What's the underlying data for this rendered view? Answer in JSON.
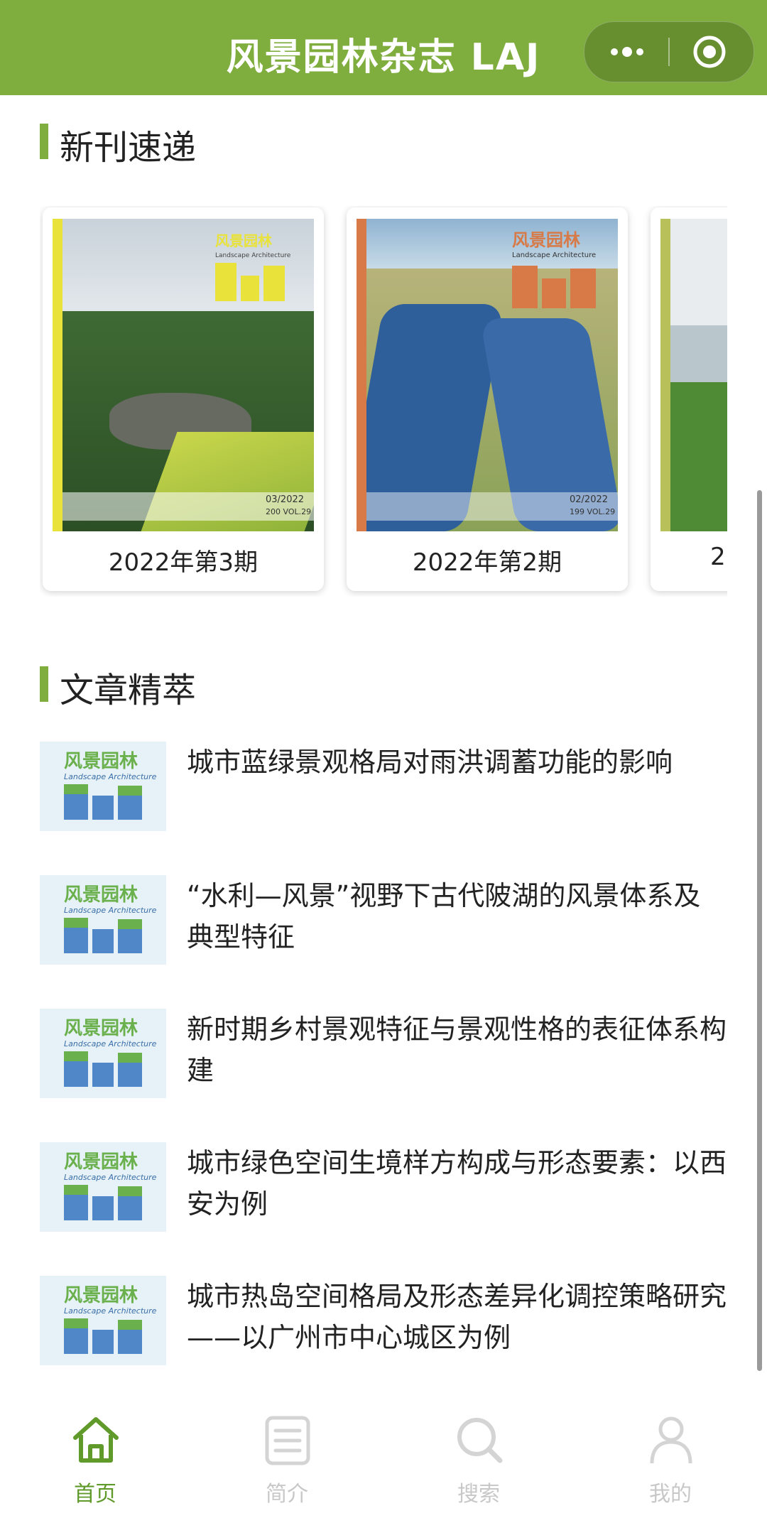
{
  "header": {
    "title": "风景园林杂志 LAJ"
  },
  "colors": {
    "brand": "#7fad3e",
    "tab_active": "#5f9a2a",
    "tab_inactive": "#c8c8c8"
  },
  "new_issues": {
    "heading": "新刊速递",
    "cards": [
      {
        "label": "2022年第3期",
        "cover_issue": "03/2022",
        "cover_vol": "200 VOL.29"
      },
      {
        "label": "2022年第2期",
        "cover_issue": "02/2022",
        "cover_vol": "199 VOL.29"
      },
      {
        "label": "2"
      }
    ],
    "cover_brand": "风景园林",
    "cover_brand_en": "Landscape Architecture"
  },
  "articles": {
    "heading": "文章精萃",
    "thumb_brand": "风景园林",
    "thumb_brand_en": "Landscape Architecture",
    "items": [
      {
        "title": "城市蓝绿景观格局对雨洪调蓄功能的影响"
      },
      {
        "title": "“水利—风景”视野下古代陂湖的风景体系及典型特征"
      },
      {
        "title": "新时期乡村景观特征与景观性格的表征体系构建"
      },
      {
        "title": "城市绿色空间生境样方构成与形态要素：以西安为例"
      },
      {
        "title": "城市热岛空间格局及形态差异化调控策略研究——以广州市中心城区为例"
      }
    ]
  },
  "tabbar": {
    "items": [
      {
        "label": "首页",
        "icon": "home-icon",
        "active": true
      },
      {
        "label": "简介",
        "icon": "document-icon",
        "active": false
      },
      {
        "label": "搜索",
        "icon": "search-icon",
        "active": false
      },
      {
        "label": "我的",
        "icon": "person-icon",
        "active": false
      }
    ]
  }
}
